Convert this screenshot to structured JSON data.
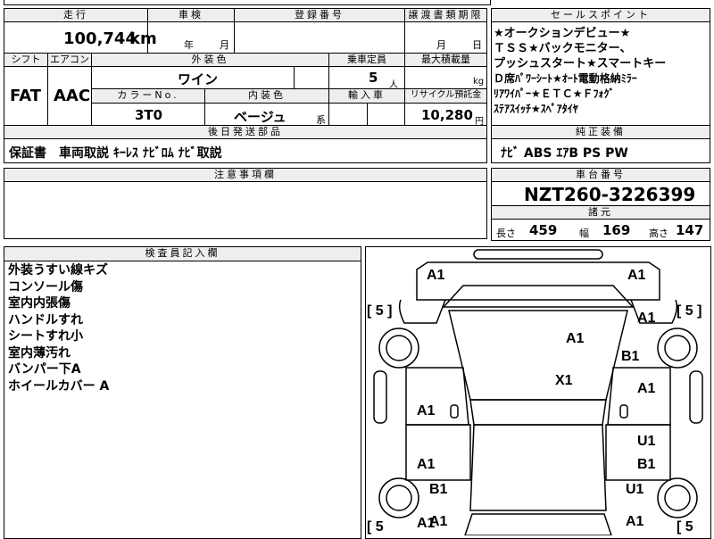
{
  "header": {
    "mileage_label": "走行",
    "inspection_label": "車検",
    "registration_label": "登録番号",
    "transfer_label": "譲渡書類期限",
    "selling_points_label": "セールスポイント"
  },
  "mileage": {
    "value": "100,744",
    "unit": "km"
  },
  "inspection": {
    "year": "年",
    "month": "月"
  },
  "transfer": {
    "month": "月",
    "day": "日"
  },
  "selling_points": [
    "★オークションデビュー★",
    "ＴＳＳ★バックモニター、",
    "プッシュスタート★スマートキー",
    "Ｄ席ﾊﾟﾜｰｼｰﾄ★ｵｰﾄ電動格納ﾐﾗｰ",
    "ﾘｱﾜｲﾊﾟｰ★ＥＴＣ★Ｆﾌｫｸﾞ",
    "ｽﾃｱｽｲｯﾁ★ｽﾍﾟｱﾀｲﾔ"
  ],
  "spec": {
    "shift_label": "シフト",
    "ac_label": "エアコン",
    "exterior_color_label": "外装色",
    "capacity_label": "乗車定員",
    "max_load_label": "最大積載量",
    "shift": "FAT",
    "ac": "AAC",
    "exterior_color": "ワイン",
    "capacity": "5",
    "capacity_unit": "人",
    "max_load_unit": "kg",
    "color_no_label": "カラーNo.",
    "interior_color_label": "内装色",
    "import_label": "輸入車",
    "recycle_label": "リサイクル預託金",
    "color_no": "3T0",
    "interior_color": "ベージュ",
    "interior_suffix": "系",
    "recycle_fee": "10,280",
    "recycle_unit": "円"
  },
  "later_items": {
    "label": "後日発送部品",
    "text": "保証書　車両取説 ｷｰﾚｽ ﾅﾋﾞﾛﾑ ﾅﾋﾞ取説"
  },
  "standard_equipment": {
    "label": "純正装備",
    "text": "ﾅﾋﾞ ABS ｴｱB PS PW"
  },
  "notes": {
    "label": "注意事項欄"
  },
  "chassis": {
    "label": "車台番号",
    "value": "NZT260-3226399"
  },
  "dimensions": {
    "label": "諸元",
    "length_label": "長さ",
    "length": "459",
    "width_label": "幅",
    "width": "169",
    "height_label": "高さ",
    "height": "147"
  },
  "inspector": {
    "label": "検査員記入欄",
    "lines": [
      "外装うすい線キズ",
      "コンソール傷",
      "室内内張傷",
      "ハンドルすれ",
      "シートすれ小",
      "室内薄汚れ",
      "バンパー下A",
      "ホイールカバー A"
    ]
  },
  "diagram": {
    "marks": [
      "A1",
      "A1",
      "A1",
      "A1",
      "B1",
      "A1",
      "X1",
      "A1",
      "A1",
      "U1",
      "A1",
      "B1",
      "B1",
      "U1",
      "A1",
      "A1"
    ],
    "brackets": [
      "[ 5 ]",
      "[ 5 ]",
      "[ 5",
      "[ 5"
    ]
  }
}
